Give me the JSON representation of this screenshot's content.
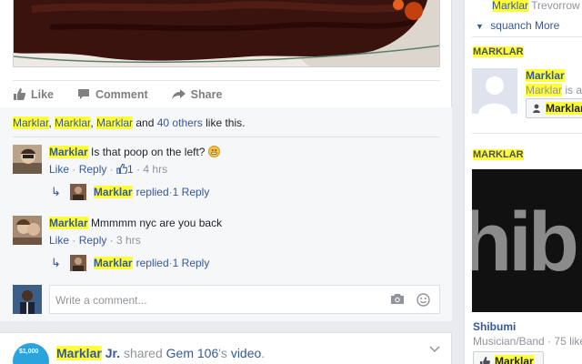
{
  "post": {
    "actions": {
      "like": "Like",
      "comment": "Comment",
      "share": "Share"
    },
    "likes": {
      "names": [
        "Marklar",
        "Marklar",
        "Marklar"
      ],
      "sep": ", ",
      "and": " and ",
      "others": "40 others",
      "suffix": " like this."
    },
    "comments": [
      {
        "name": "Marklar",
        "text": "Is that poop on the left?",
        "like": "Like",
        "reply": "Reply",
        "like_count": "1",
        "time": "4 hrs",
        "reply_name": "Marklar",
        "reply_action": "replied",
        "reply_count": "1 Reply"
      },
      {
        "name": "Marklar",
        "text": "Mmmmm nyc are you back",
        "like": "Like",
        "reply": "Reply",
        "time": "3 hrs",
        "reply_name": "Marklar",
        "reply_action": "replied",
        "reply_count": "1 Reply"
      }
    ],
    "dot": " · ",
    "write_placeholder": "Write a comment..."
  },
  "post2": {
    "author": "Marklar",
    "author_suffix": " Jr.",
    "shared": " shared ",
    "page": "Gem 106",
    "possessive": "'s ",
    "object": "video",
    "end": ".",
    "logo_text": "$1,000"
  },
  "sidebar": {
    "top_name": "Marklar",
    "top_rest": " Trevorrow",
    "more_label": "squanch More",
    "section1_title": "MARKLAR",
    "person_name": "Marklar",
    "person_sub_hl": "Marklar",
    "person_sub_rest": " is a",
    "add_button": "Marklar",
    "section2_title": "MARKLAR",
    "page_name": "Shibumi",
    "page_cat": "Musician/Band",
    "page_likes": "· 75 like",
    "like_button": "Marklar",
    "cover_text": "hib"
  },
  "colors": {
    "highlight": "#ffff3a",
    "link": "#365899",
    "muted": "#90949c"
  }
}
